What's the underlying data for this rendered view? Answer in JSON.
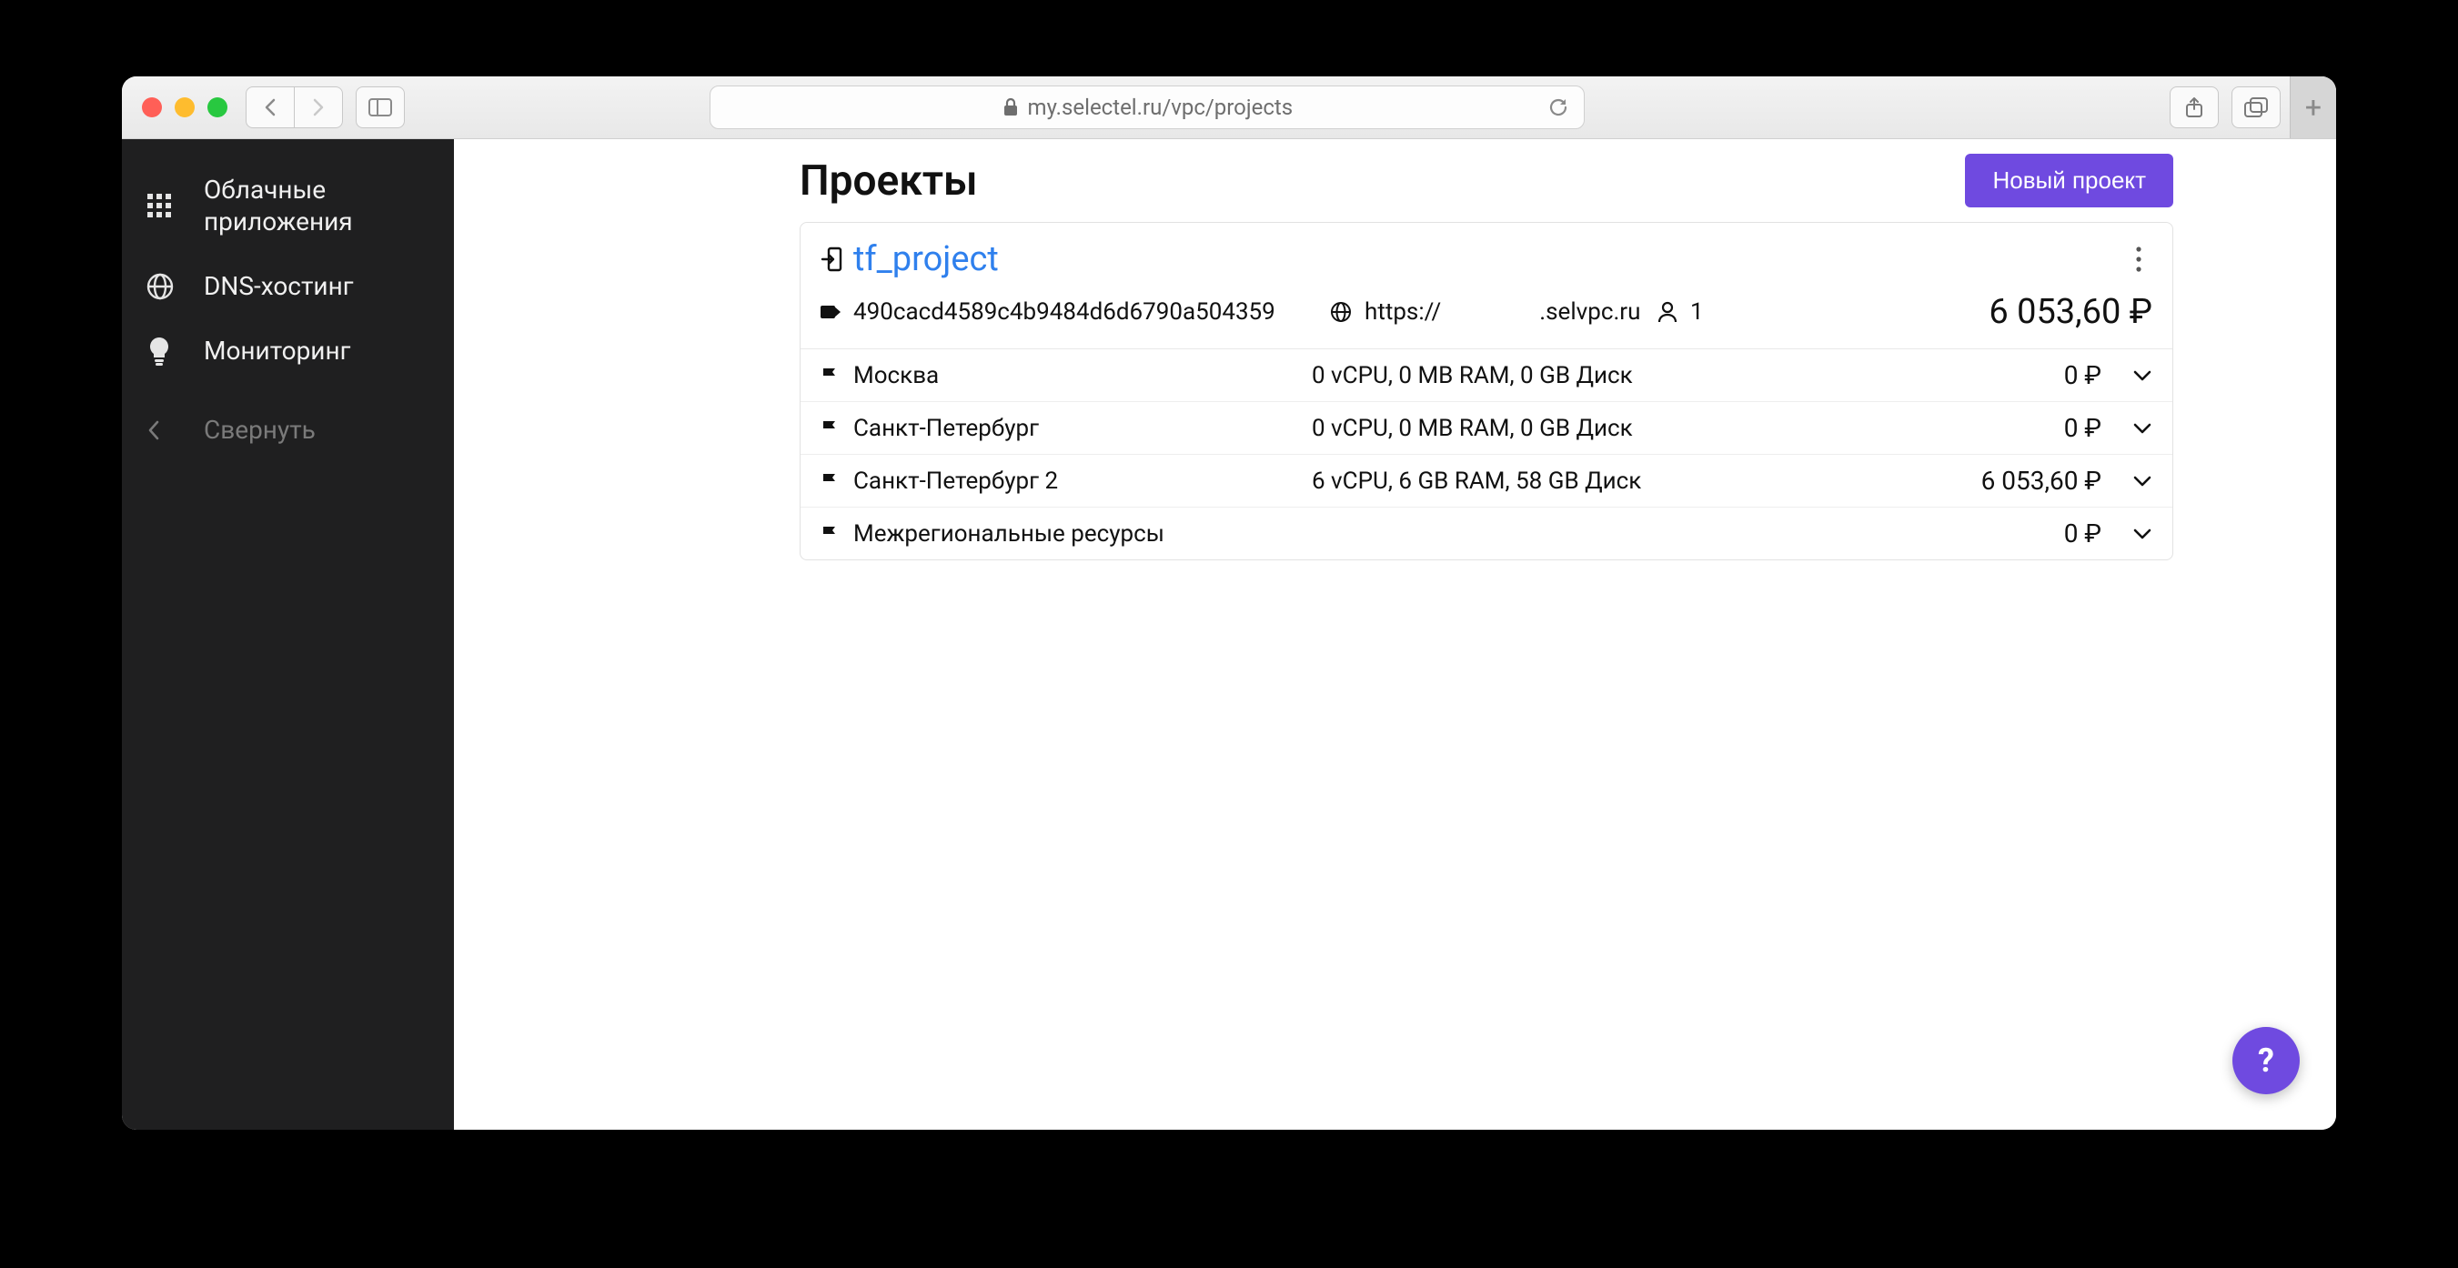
{
  "browser": {
    "url": "my.selectel.ru/vpc/projects"
  },
  "sidebar": {
    "items": [
      {
        "label": "Облачные\nприложения",
        "icon": "apps-icon"
      },
      {
        "label": "DNS-хостинг",
        "icon": "globe-icon"
      },
      {
        "label": "Мониторинг",
        "icon": "lightbulb-icon"
      }
    ],
    "collapse_label": "Свернуть"
  },
  "page": {
    "title": "Проекты",
    "new_project_label": "Новый проект"
  },
  "project": {
    "name": "tf_project",
    "id": "490cacd4589c4b9484d6d6790a504359",
    "url_prefix": "https://",
    "url_suffix": ".selvpc.ru",
    "users": "1",
    "price": "6 053,60 ₽"
  },
  "regions": [
    {
      "name": "Москва",
      "specs": "0 vCPU, 0 MB RAM, 0 GB Диск",
      "price": "0 ₽"
    },
    {
      "name": "Санкт-Петербург",
      "specs": "0 vCPU, 0 MB RAM, 0 GB Диск",
      "price": "0 ₽"
    },
    {
      "name": "Санкт-Петербург 2",
      "specs": "6 vCPU, 6 GB RAM, 58 GB Диск",
      "price": "6 053,60 ₽"
    },
    {
      "name": "Межрегиональные ресурсы",
      "specs": "",
      "price": "0 ₽"
    }
  ],
  "help": {
    "label": "?"
  }
}
